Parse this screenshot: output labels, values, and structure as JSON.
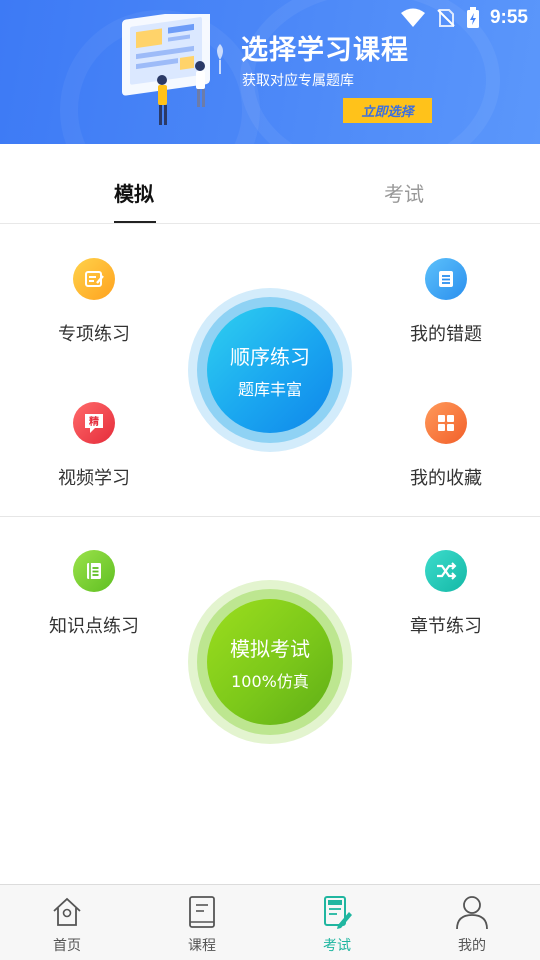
{
  "status_bar": {
    "time": "9:55"
  },
  "banner": {
    "title": "选择学习课程",
    "subtitle": "获取对应专属题库",
    "button_label": "立即选择"
  },
  "tabs": [
    {
      "label": "模拟",
      "active": true
    },
    {
      "label": "考试",
      "active": false
    }
  ],
  "section1": {
    "items": [
      {
        "label": "专项练习",
        "icon": "edit-note-icon",
        "color": "#ffb62e"
      },
      {
        "label": "我的错题",
        "icon": "document-list-icon",
        "color": "#3aa7f2"
      },
      {
        "label": "视频学习",
        "icon": "jing-badge-icon",
        "color": "#f2464e"
      },
      {
        "label": "我的收藏",
        "icon": "grid-squares-icon",
        "color": "#ff7a3c"
      }
    ],
    "center": {
      "title": "顺序练习",
      "subtitle": "题库丰富"
    }
  },
  "section2": {
    "items": [
      {
        "label": "知识点练习",
        "icon": "book-list-icon",
        "color": "#7ed02d"
      },
      {
        "label": "章节练习",
        "icon": "shuffle-icon",
        "color": "#1ec9b5"
      }
    ],
    "center": {
      "title": "模拟考试",
      "subtitle": "100%仿真"
    }
  },
  "bottom_nav": [
    {
      "label": "首页",
      "icon": "home-icon",
      "active": false
    },
    {
      "label": "课程",
      "icon": "book-icon",
      "active": false
    },
    {
      "label": "考试",
      "icon": "exam-edit-icon",
      "active": true
    },
    {
      "label": "我的",
      "icon": "user-icon",
      "active": false
    }
  ],
  "colors": {
    "accent": "#20b6a0",
    "banner_blue": "#4a86f7",
    "banner_button": "#ffc21a"
  }
}
